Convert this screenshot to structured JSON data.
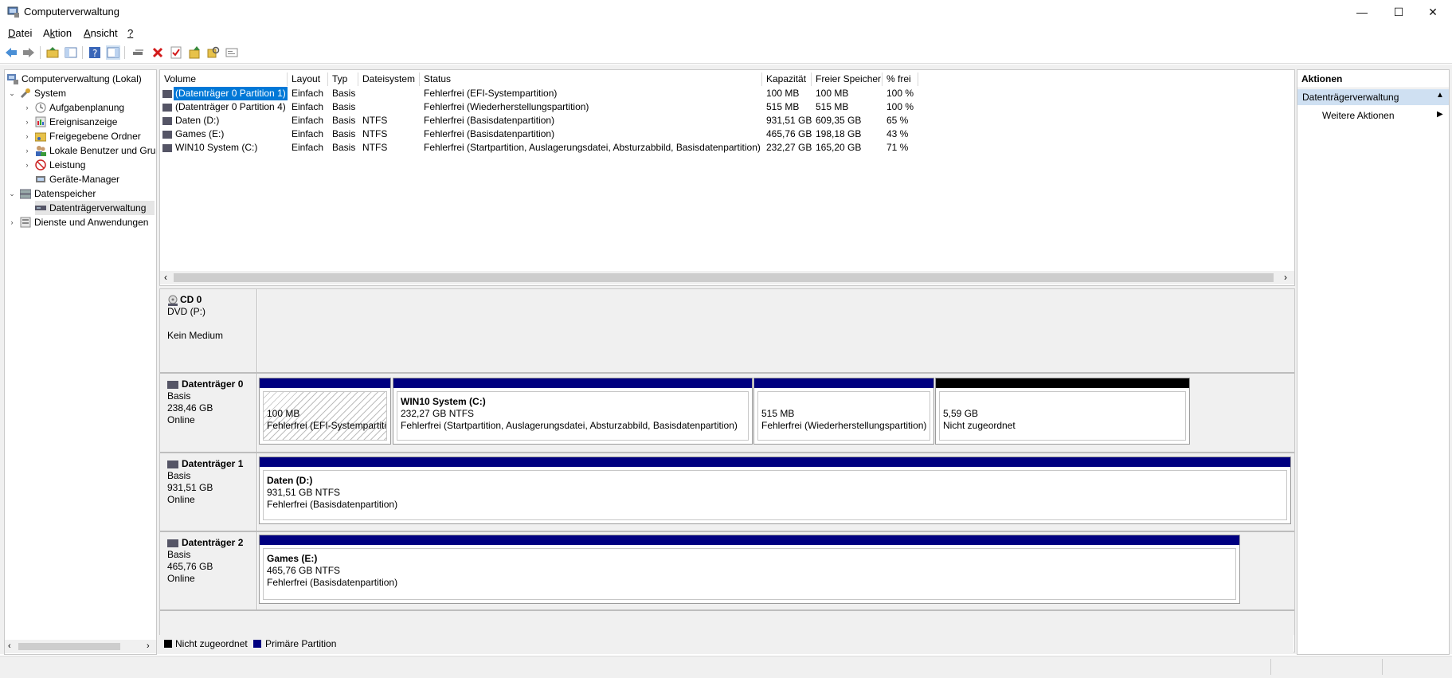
{
  "window": {
    "title": "Computerverwaltung",
    "controls": {
      "minimize": "—",
      "maximize": "☐",
      "close": "✕"
    }
  },
  "menu": [
    {
      "label": "Datei",
      "underline": "D",
      "rest": "atei"
    },
    {
      "label": "Aktion",
      "pre": "A",
      "underline": "k",
      "rest": "tion"
    },
    {
      "label": "Ansicht",
      "underline": "A",
      "rest": "nsicht"
    },
    {
      "label": "?",
      "underline": "?",
      "rest": ""
    }
  ],
  "tree": {
    "items": [
      {
        "label": "Computerverwaltung (Lokal)",
        "icon": "computer-management-icon"
      },
      {
        "label": "System",
        "icon": "system-tools-icon",
        "expander": "⌄"
      },
      {
        "label": "Aufgabenplanung",
        "icon": "clock-icon",
        "expander": "›"
      },
      {
        "label": "Ereignisanzeige",
        "icon": "event-viewer-icon",
        "expander": "›"
      },
      {
        "label": "Freigegebene Ordner",
        "icon": "shared-folder-icon",
        "expander": "›"
      },
      {
        "label": "Lokale Benutzer und Gruppen",
        "icon": "users-icon",
        "expander": "›"
      },
      {
        "label": "Leistung",
        "icon": "performance-icon",
        "expander": "›"
      },
      {
        "label": "Geräte-Manager",
        "icon": "device-manager-icon"
      },
      {
        "label": "Datenspeicher",
        "icon": "storage-icon",
        "expander": "⌄"
      },
      {
        "label": "Datenträgerverwaltung",
        "icon": "disk-management-icon"
      },
      {
        "label": "Dienste und Anwendungen",
        "icon": "services-icon",
        "expander": "›"
      }
    ]
  },
  "volumes": {
    "columns": [
      "Volume",
      "Layout",
      "Typ",
      "Dateisystem",
      "Status",
      "Kapazität",
      "Freier Speicher",
      "% frei"
    ],
    "rows": [
      {
        "volume": "(Datenträger 0 Partition 1)",
        "layout": "Einfach",
        "typ": "Basis",
        "fs": "",
        "status": "Fehlerfrei (EFI-Systempartition)",
        "cap": "100 MB",
        "free": "100 MB",
        "pct": "100 %"
      },
      {
        "volume": "(Datenträger 0 Partition 4)",
        "layout": "Einfach",
        "typ": "Basis",
        "fs": "",
        "status": "Fehlerfrei (Wiederherstellungspartition)",
        "cap": "515 MB",
        "free": "515 MB",
        "pct": "100 %"
      },
      {
        "volume": "Daten (D:)",
        "layout": "Einfach",
        "typ": "Basis",
        "fs": "NTFS",
        "status": "Fehlerfrei (Basisdatenpartition)",
        "cap": "931,51 GB",
        "free": "609,35 GB",
        "pct": "65 %"
      },
      {
        "volume": "Games (E:)",
        "layout": "Einfach",
        "typ": "Basis",
        "fs": "NTFS",
        "status": "Fehlerfrei (Basisdatenpartition)",
        "cap": "465,76 GB",
        "free": "198,18 GB",
        "pct": "43 %"
      },
      {
        "volume": "WIN10 System (C:)",
        "layout": "Einfach",
        "typ": "Basis",
        "fs": "NTFS",
        "status": "Fehlerfrei (Startpartition, Auslagerungsdatei, Absturzabbild, Basisdatenpartition)",
        "cap": "232,27 GB",
        "free": "165,20 GB",
        "pct": "71 %"
      }
    ]
  },
  "disks": {
    "cd0": {
      "name": "CD 0",
      "line1": "DVD (P:)",
      "line2": "",
      "line3": "Kein Medium"
    },
    "disk0": {
      "name": "Datenträger 0",
      "type": "Basis",
      "size": "238,46 GB",
      "state": "Online",
      "parts": [
        {
          "title": "",
          "size": "100 MB",
          "status": "Fehlerfrei (EFI-Systempartition)"
        },
        {
          "title": "WIN10 System  (C:)",
          "size": "232,27 GB NTFS",
          "status": "Fehlerfrei (Startpartition, Auslagerungsdatei, Absturzabbild, Basisdatenpartition)"
        },
        {
          "title": "",
          "size": "515 MB",
          "status": "Fehlerfrei (Wiederherstellungspartition)"
        },
        {
          "title": "",
          "size": "5,59 GB",
          "status": "Nicht zugeordnet"
        }
      ]
    },
    "disk1": {
      "name": "Datenträger 1",
      "type": "Basis",
      "size": "931,51 GB",
      "state": "Online",
      "parts": [
        {
          "title": "Daten  (D:)",
          "size": "931,51 GB NTFS",
          "status": "Fehlerfrei (Basisdatenpartition)"
        }
      ]
    },
    "disk2": {
      "name": "Datenträger 2",
      "type": "Basis",
      "size": "465,76 GB",
      "state": "Online",
      "parts": [
        {
          "title": "Games  (E:)",
          "size": "465,76 GB NTFS",
          "status": "Fehlerfrei (Basisdatenpartition)"
        }
      ]
    }
  },
  "legend": {
    "unallocated": "Nicht zugeordnet",
    "primary": "Primäre Partition"
  },
  "actions": {
    "header": "Aktionen",
    "section": "Datenträgerverwaltung",
    "more": "Weitere Aktionen"
  },
  "colors": {
    "primary_partition": "#000080",
    "unallocated": "#000000",
    "selection": "#0078d7",
    "actions_section": "#cfe0f2"
  }
}
